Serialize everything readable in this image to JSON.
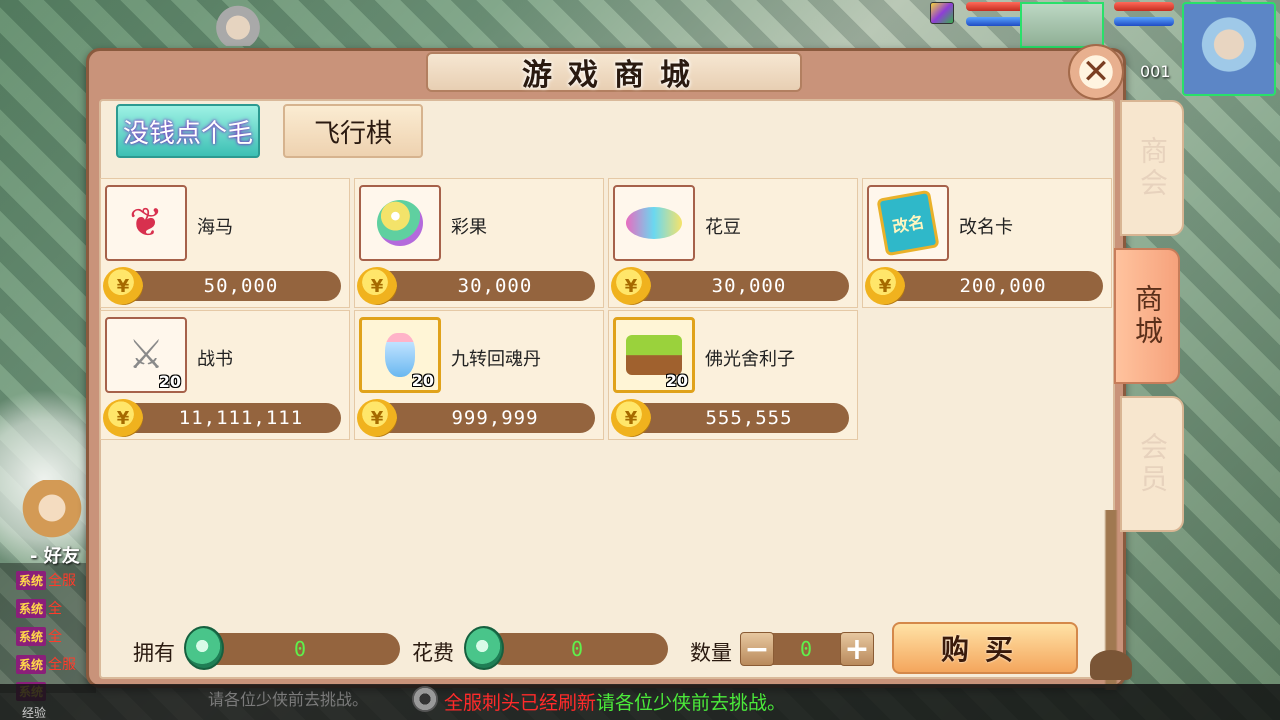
{
  "window": {
    "title": "游戏商城"
  },
  "hud": {
    "level": "001"
  },
  "category_tabs": [
    {
      "label": "没钱点个毛",
      "active": true
    },
    {
      "label": "飞行棋",
      "active": false
    }
  ],
  "side_tabs": [
    {
      "label": "商会",
      "active": false
    },
    {
      "label": "商城",
      "active": true
    },
    {
      "label": "会员",
      "active": false
    }
  ],
  "items": [
    {
      "name": "海马",
      "price": "50,000",
      "count": "",
      "icon": "seahorse-icon"
    },
    {
      "name": "彩果",
      "price": "30,000",
      "count": "",
      "icon": "rainbow-fruit-icon"
    },
    {
      "name": "花豆",
      "price": "30,000",
      "count": "",
      "icon": "flower-bean-icon"
    },
    {
      "name": "改名卡",
      "price": "200,000",
      "count": "",
      "icon": "rename-card-icon"
    },
    {
      "name": "战书",
      "price": "11,111,111",
      "count": "20",
      "icon": "crossed-swords-icon"
    },
    {
      "name": "九转回魂丹",
      "price": "999,999",
      "count": "20",
      "icon": "potion-bottle-icon"
    },
    {
      "name": "佛光舍利子",
      "price": "555,555",
      "count": "20",
      "icon": "relic-basket-icon"
    }
  ],
  "item_icon_text": {
    "rename_card": "改名"
  },
  "bottom": {
    "own_label": "拥有",
    "own_value": "0",
    "cost_label": "花费",
    "cost_value": "0",
    "qty_label": "数量",
    "qty_value": "0",
    "minus": "−",
    "plus": "+",
    "buy_label": "购买"
  },
  "chat": {
    "friends_label": "好友",
    "sys_tag": "系统",
    "lines": [
      "全服",
      "全",
      "全",
      "全服",
      ""
    ]
  },
  "marquee": {
    "red_part": "全服刺头已经刷新",
    "green_part": "请各位少侠前去挑战。",
    "behind_text": "请各位少侠前去挑战。"
  },
  "exp_label": "经验",
  "colors": {
    "panel_bg": "#f7ecd9",
    "price_bar": "#94643e",
    "active_tab": "#3cc0b4",
    "value_green": "#5ff04c",
    "marquee_red": "#ff2a2a",
    "marquee_green": "#4bea3a"
  }
}
